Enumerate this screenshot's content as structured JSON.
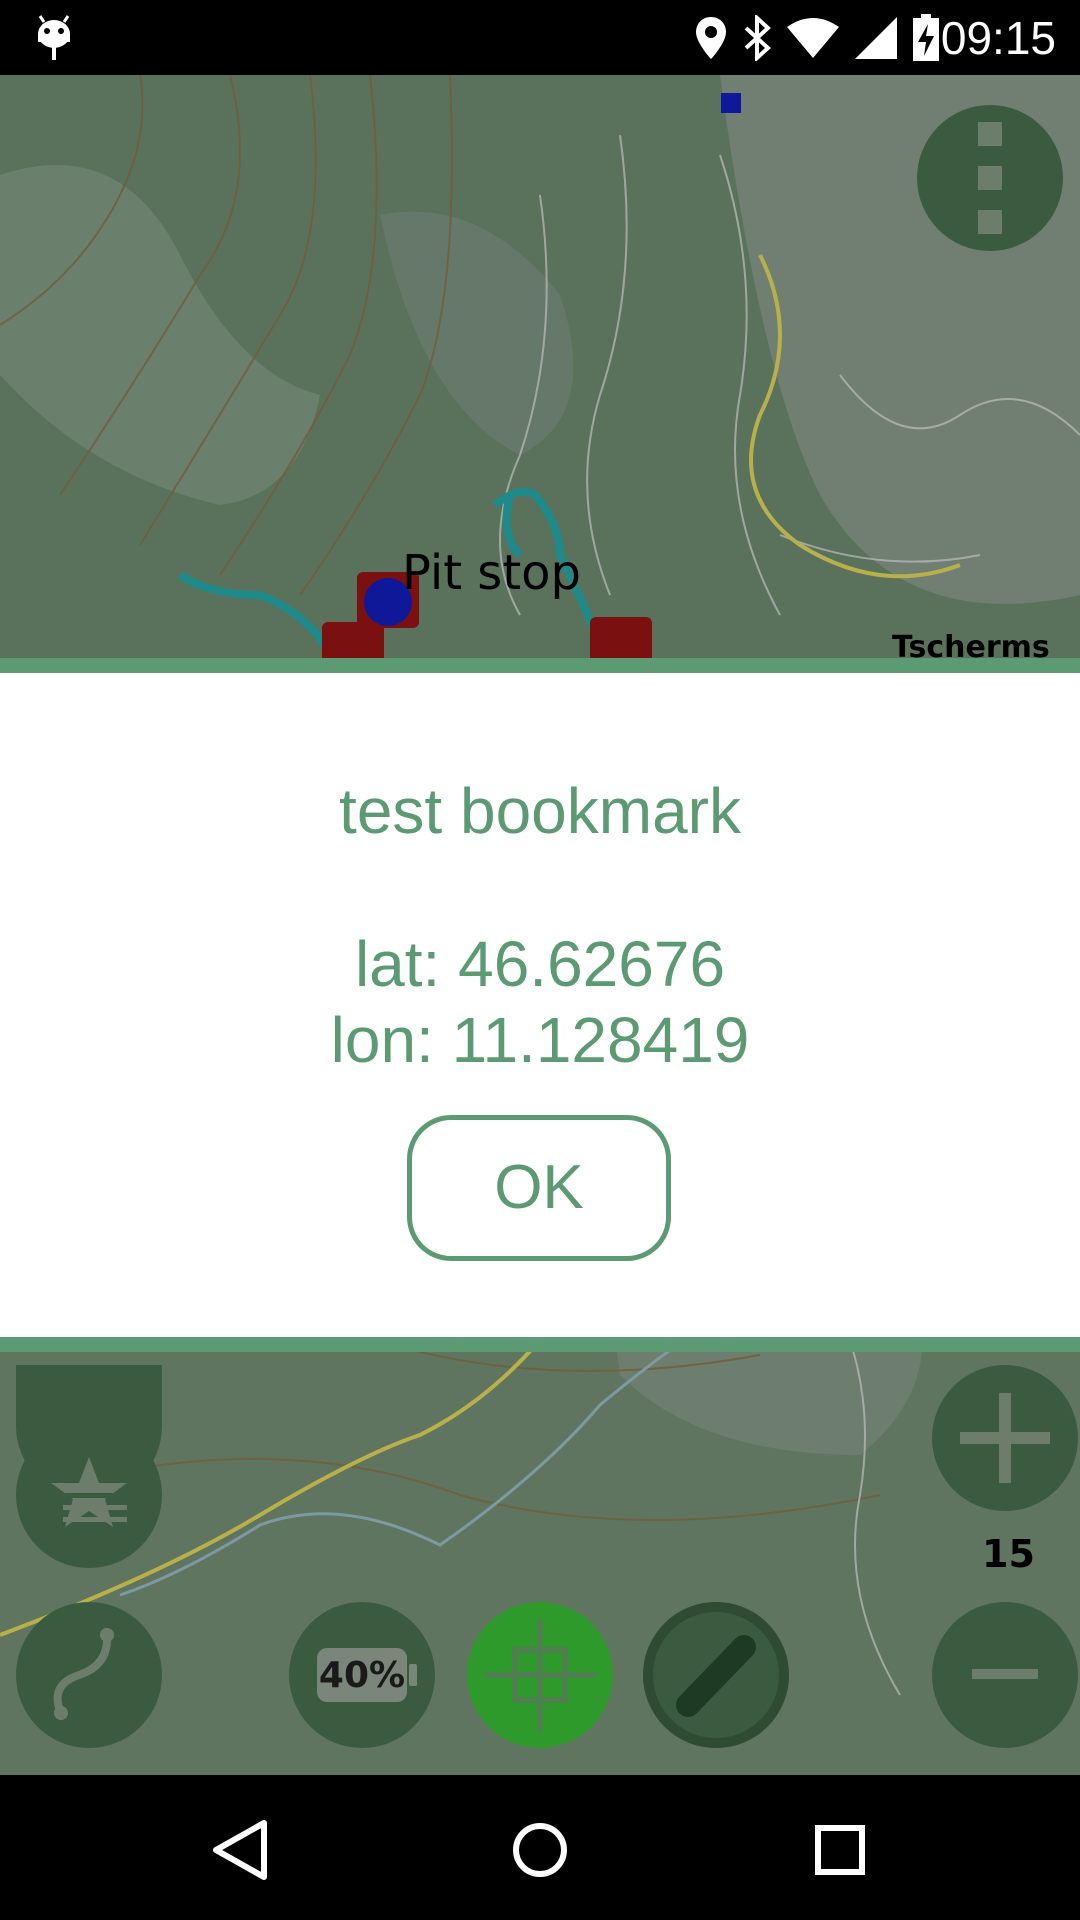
{
  "status_bar": {
    "time": "09:15",
    "icons": [
      "android-debug-icon",
      "location-icon",
      "bluetooth-icon",
      "wifi-icon",
      "signal-icon",
      "battery-charging-icon"
    ]
  },
  "map": {
    "labels": {
      "pit_stop": "Pit stop",
      "place": "Tscherms",
      "zoom_level": "15"
    },
    "battery_button_label": "40%",
    "buttons": [
      "menu-button",
      "bookmarks-button",
      "track-button",
      "battery-button",
      "center-crosshair-button",
      "edit-button",
      "zoom-in-button",
      "zoom-out-button"
    ],
    "colors": {
      "tint": "#58705a",
      "fab": "#3b5b40",
      "fab_active": "#2f9a2c",
      "track": "#1f8a8a",
      "route": "#8a1414",
      "poi": "#7a1010",
      "position_dot": "#10189a"
    }
  },
  "dialog": {
    "title": "test bookmark",
    "lat_line": "lat: 46.62676",
    "lon_line": "lon: 11.128419",
    "ok_label": "OK",
    "accent_color": "#5b9a72"
  },
  "nav_bar": {
    "buttons": [
      "back-icon",
      "home-icon",
      "recents-icon"
    ]
  }
}
